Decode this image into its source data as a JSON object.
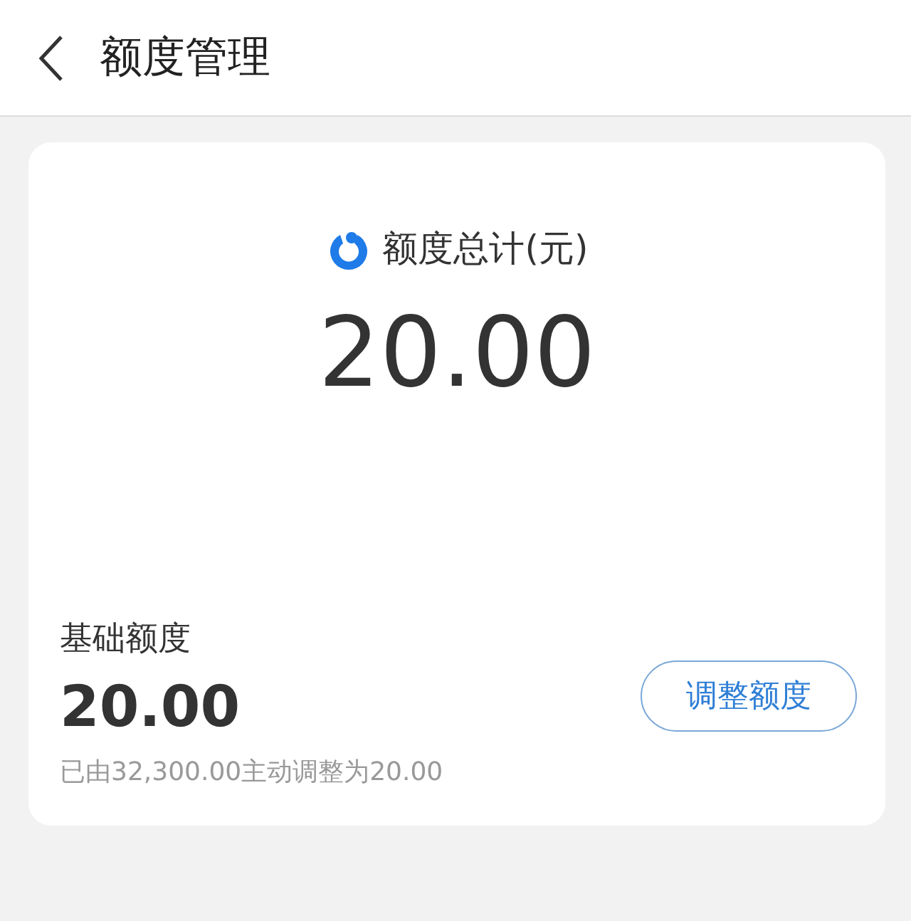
{
  "header": {
    "title": "额度管理"
  },
  "total": {
    "label": "额度总计(元)",
    "amount": "20.00"
  },
  "base": {
    "label": "基础额度",
    "amount": "20.00",
    "note": "已由32,300.00主动调整为20.00",
    "button": "调整额度"
  }
}
